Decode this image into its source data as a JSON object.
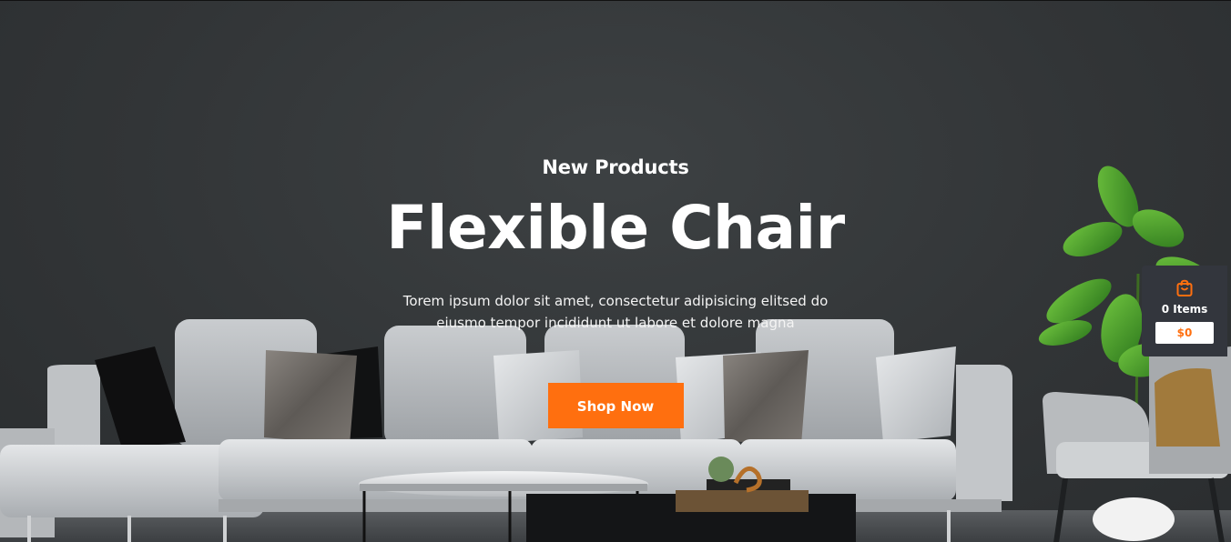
{
  "hero": {
    "subtitle": "New Products",
    "title": "Flexible Chair",
    "description": "Torem ipsum dolor sit amet, consectetur adipisicing elitsed do eiusmo tempor incididunt ut labore et dolore magna",
    "button_label": "Shop Now"
  },
  "cart": {
    "icon": "shopping-bag-icon",
    "items_label": "0 Items",
    "total": "$0"
  },
  "colors": {
    "accent": "#ff6f0f",
    "background": "#323537",
    "cart_bg": "#33363d"
  }
}
